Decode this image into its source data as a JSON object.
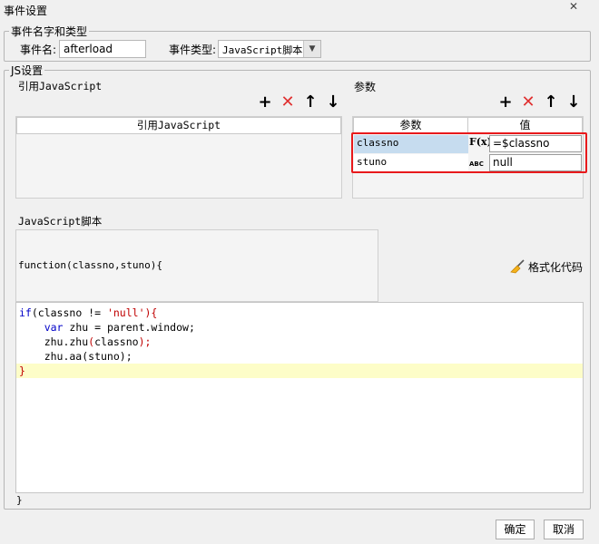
{
  "window": {
    "title": "事件设置",
    "close_glyph": "✕"
  },
  "event_group": {
    "legend": "事件名字和类型",
    "name_label": "事件名:",
    "name_value": "afterload",
    "type_label": "事件类型:",
    "type_value": "JavaScript脚本"
  },
  "js_group": {
    "legend": "JS设置",
    "ref_section": {
      "label": "引用JavaScript",
      "column_header": "引用JavaScript"
    },
    "param_section": {
      "label": "参数",
      "headers": [
        "参数",
        "值"
      ],
      "rows": [
        {
          "name": "classno",
          "type_icon": "F(x)",
          "value": "=$classno"
        },
        {
          "name": "stuno",
          "type_icon": "ABC",
          "value": "null"
        }
      ]
    },
    "toolbar_glyphs": {
      "add": "+",
      "delete": "✕",
      "up": "↑",
      "down": "↓"
    },
    "script_label": "JavaScript脚本",
    "function_signature": "function(classno,stuno){",
    "format_button": "格式化代码",
    "code_lines": [
      [
        {
          "t": "if",
          "c": "kw"
        },
        {
          "t": "(classno != ",
          "c": ""
        },
        {
          "t": "'null'",
          "c": "str"
        },
        {
          "t": "){",
          "c": "brace"
        }
      ],
      [
        {
          "t": "    ",
          "c": ""
        },
        {
          "t": "var",
          "c": "kw"
        },
        {
          "t": " zhu = parent.window;",
          "c": ""
        }
      ],
      [
        {
          "t": "    zhu.zhu",
          "c": ""
        },
        {
          "t": "(",
          "c": "brace"
        },
        {
          "t": "classno",
          "c": ""
        },
        {
          "t": ");",
          "c": "brace"
        }
      ],
      [
        {
          "t": "    zhu.aa(stuno);",
          "c": ""
        }
      ],
      [
        {
          "t": "}",
          "c": "brace"
        }
      ]
    ],
    "closing_brace": "}"
  },
  "buttons": {
    "ok": "确定",
    "cancel": "取消"
  },
  "colors": {
    "highlight_border": "#e8191c",
    "selected_cell": "#c6dcef",
    "current_line": "#fdfdc8",
    "delete_icon": "#e03030"
  }
}
